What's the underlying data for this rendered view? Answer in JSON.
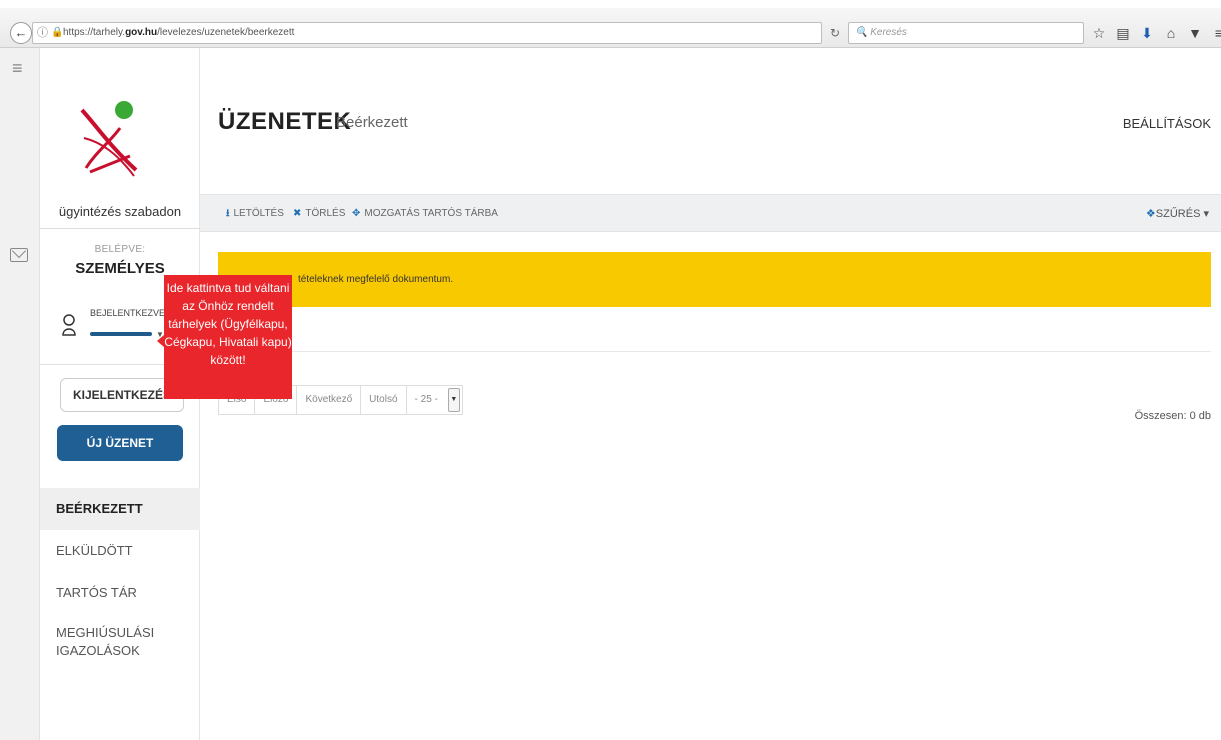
{
  "browser": {
    "url_prefix": "https://tarhely.",
    "url_domain": "gov.hu",
    "url_path": "/levelezes/uzenetek/beerkezett",
    "search_placeholder": "Keresés",
    "icons": [
      "back-icon",
      "info-icon",
      "lock-icon",
      "reload-icon",
      "search-icon",
      "bookmark-star-icon",
      "reading-list-icon",
      "download-icon",
      "home-icon",
      "pocket-icon",
      "menu-icon"
    ]
  },
  "sidebar": {
    "tagline": "ügyintézés szabadon",
    "logged_in_label": "BELÉPVE:",
    "account_type": "SZEMÉLYES",
    "logged_in_as": "BEJELENTKEZVE",
    "logout_label": "KIJELENTKEZÉS",
    "new_message_label": "ÚJ ÜZENET",
    "nav": [
      {
        "label": "BEÉRKEZETT",
        "active": true
      },
      {
        "label": "ELKÜLDÖTT",
        "active": false
      },
      {
        "label": "TARTÓS TÁR",
        "active": false
      },
      {
        "label": "MEGHIÚSULÁSI IGAZOLÁSOK",
        "active": false
      }
    ]
  },
  "header": {
    "title": "ÜZENETEK",
    "subtitle": "Beérkezett",
    "settings_label": "BEÁLLÍTÁSOK"
  },
  "toolbar": {
    "download_label": "LETÖLTÉS",
    "delete_label": "TÖRLÉS",
    "move_label": "MOZGATÁS TARTÓS TÁRBA",
    "filter_label": "SZŰRÉS"
  },
  "alert": {
    "text": "tételeknek megfelelő dokumentum."
  },
  "pager": {
    "first": "Első",
    "prev": "Előző",
    "next": "Következő",
    "last": "Utolsó",
    "page_size": "- 25 -",
    "total": "Összesen: 0 db"
  },
  "tooltip": {
    "lines": [
      "Ide kattintva tud váltani",
      "az Önhöz rendelt",
      "tárhelyek (Ügyfélkapu,",
      "Cégkapu, Hivatali kapu)",
      "között!"
    ]
  },
  "colors": {
    "primary": "#1f5f93",
    "alert": "#f9c900",
    "tooltip": "#e8262b",
    "logo_green": "#3aa835",
    "logo_red": "#c8102e"
  }
}
